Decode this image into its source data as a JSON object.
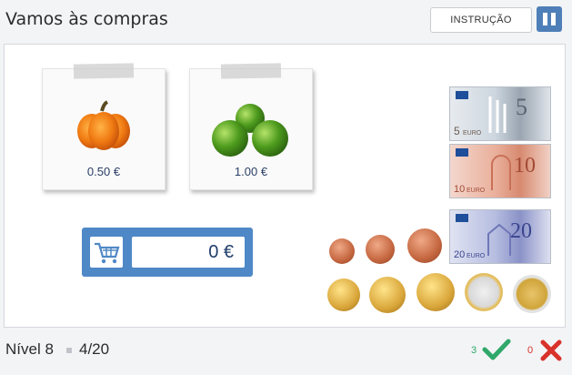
{
  "header": {
    "title": "Vamos às compras",
    "instruction_label": "INSTRUÇÃO"
  },
  "products": [
    {
      "name": "pumpkin",
      "price": "0.50 €"
    },
    {
      "name": "apples",
      "price": "1.00 €"
    }
  ],
  "cart": {
    "total": "0 €"
  },
  "money": {
    "notes": [
      "5",
      "10",
      "20"
    ],
    "coins": [
      "1",
      "2",
      "5",
      "10",
      "20",
      "50",
      "1",
      "2"
    ]
  },
  "footer": {
    "level": "Nível 8",
    "progress": "4/20",
    "correct_count": "3",
    "wrong_count": "0"
  },
  "colors": {
    "accent": "#4f88c6",
    "correct": "#2fa86a",
    "wrong": "#d8322b"
  }
}
